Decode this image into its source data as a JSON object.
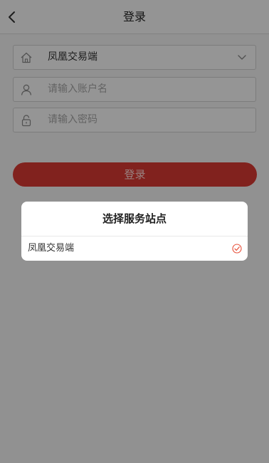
{
  "header": {
    "title": "登录"
  },
  "form": {
    "station_value": "凤凰交易端",
    "account_placeholder": "请输入账户名",
    "password_placeholder": "请输入密码",
    "login_label": "登录"
  },
  "dialog": {
    "title": "选择服务站点",
    "options": [
      {
        "label": "凤凰交易端",
        "selected": true
      }
    ]
  },
  "colors": {
    "brand": "#d83a33",
    "check": "#e8503a",
    "overlay": "rgba(0,0,0,0.4)"
  },
  "icons": [
    "back-icon",
    "home-icon",
    "chevron-down-icon",
    "user-icon",
    "lock-icon",
    "check-circle-icon"
  ]
}
